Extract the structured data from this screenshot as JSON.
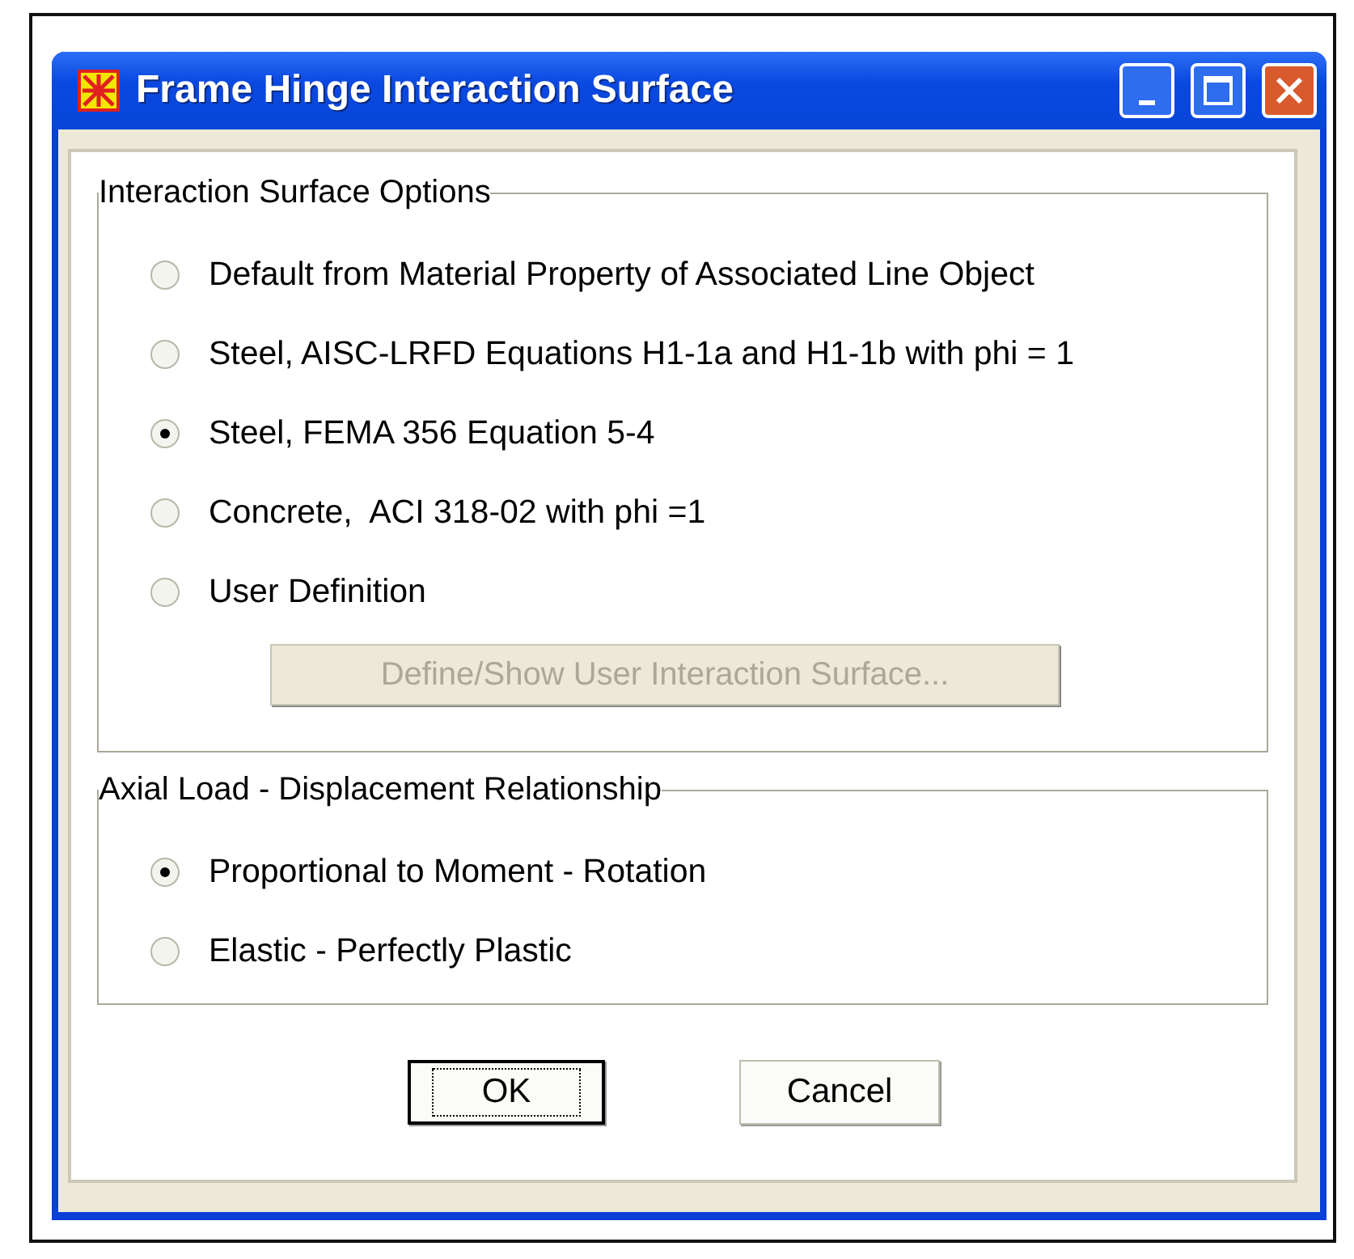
{
  "window": {
    "title": "Frame Hinge Interaction Surface"
  },
  "groups": [
    {
      "title": "Interaction Surface Options",
      "options": [
        {
          "label": "Default from Material Property of Associated Line Object",
          "selected": false
        },
        {
          "label": "Steel, AISC-LRFD Equations H1-1a and H1-1b with phi = 1",
          "selected": false
        },
        {
          "label": "Steel, FEMA 356 Equation 5-4",
          "selected": true
        },
        {
          "label": "Concrete,  ACI 318-02 with phi =1",
          "selected": false
        },
        {
          "label": "User Definition",
          "selected": false
        }
      ],
      "button": {
        "label": "Define/Show User Interaction Surface...",
        "disabled": true
      }
    },
    {
      "title": "Axial Load - Displacement Relationship",
      "options": [
        {
          "label": "Proportional to Moment - Rotation",
          "selected": true
        },
        {
          "label": "Elastic - Perfectly Plastic",
          "selected": false
        }
      ]
    }
  ],
  "buttons": [
    {
      "label": "OK",
      "focused": true
    },
    {
      "label": "Cancel",
      "focused": false
    }
  ]
}
